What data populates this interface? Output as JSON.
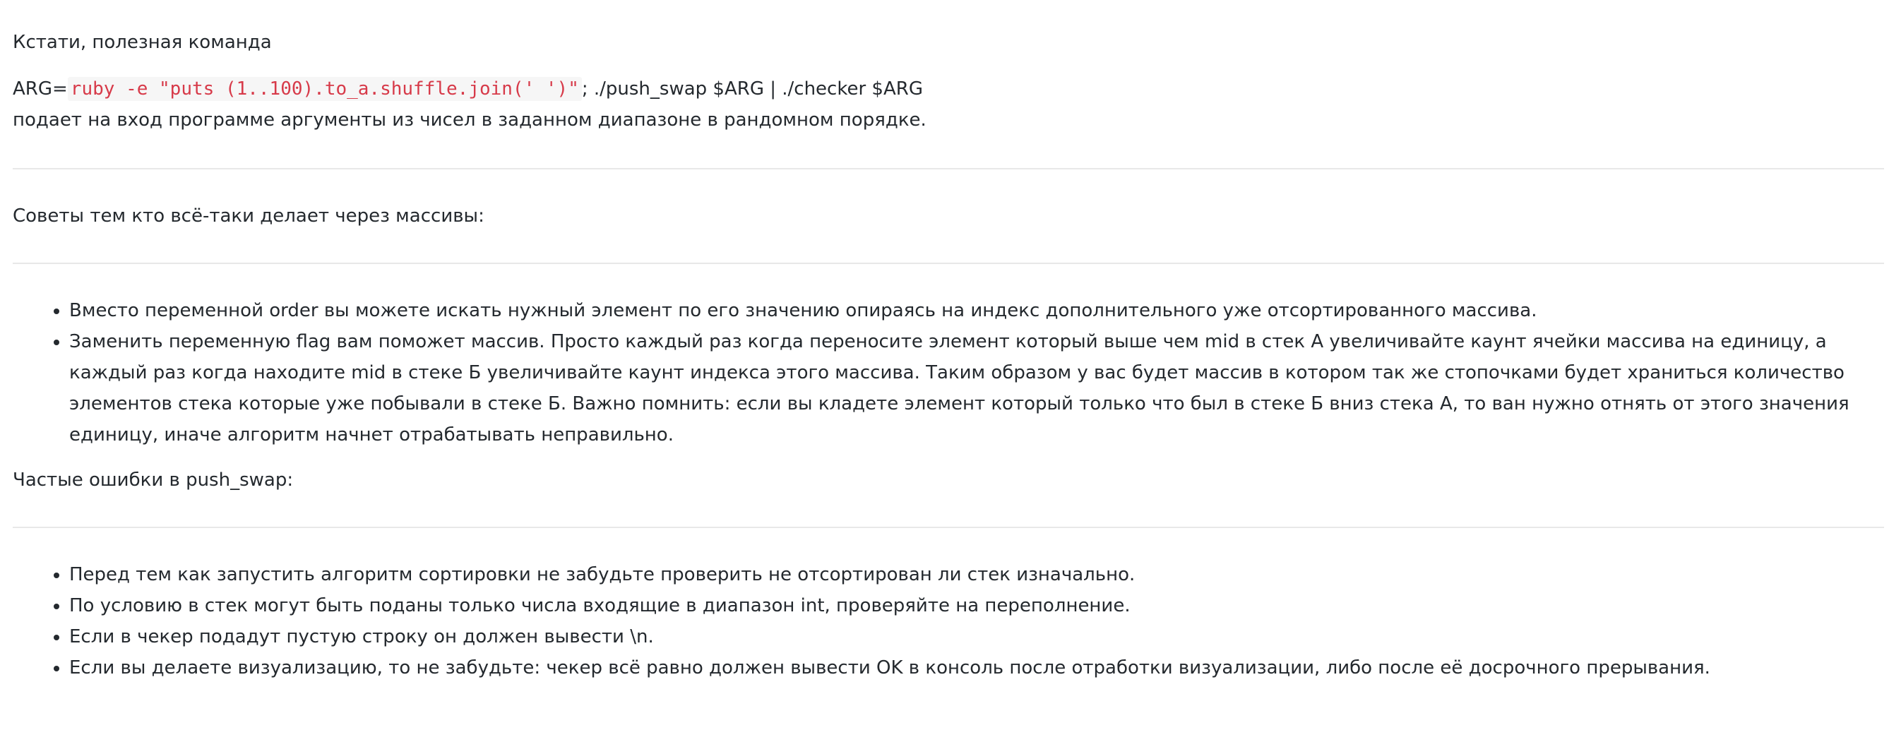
{
  "intro": {
    "tip_label": "Кстати, полезная команда",
    "command_prefix": "ARG=",
    "command_code": "ruby -e \"puts (1..100).to_a.shuffle.join(' ')\"",
    "command_suffix": "; ./push_swap $ARG | ./checker $ARG",
    "command_description": "подает на вход программе аргументы из чисел в заданном диапазоне в рандомном порядке."
  },
  "advice": {
    "heading": "Советы тем кто всё-таки делает через массивы:",
    "items": [
      "Вместо переменной order вы можете искать нужный элемент по его значению опираясь на индекс дополнительного уже отсортированного массива.",
      "Заменить переменную flag вам поможет массив. Просто каждый раз когда переносите элемент который выше чем mid в стек А увеличивайте каунт ячейки массива на единицу, а каждый раз когда находите mid в стеке Б увеличивайте каунт индекса этого массива. Таким образом у вас будет массив в котором так же стопочками будет храниться количество элементов стека которые уже побывали в стеке Б. Важно помнить: если вы кладете элемент который только что был в стеке Б вниз стека А, то ван нужно отнять от этого значения единицу, иначе алгоритм начнет отрабатывать неправильно."
    ]
  },
  "errors": {
    "heading": "Частые ошибки в push_swap:",
    "items": [
      "Перед тем как запустить алгоритм сортировки не забудьте проверить не отсортирован ли стек изначально.",
      "По условию в стек могут быть поданы только числа входящие в диапазон int, проверяйте на переполнение.",
      "Если в чекер подадут пустую строку он должен вывести \\n.",
      "Если вы делаете визуализацию, то не забудьте: чекер всё равно должен вывести OK в консоль после отработки визуализации, либо после её досрочного прерывания."
    ]
  },
  "colors": {
    "text": "#24292e",
    "code_text": "#d73a49",
    "code_background": "#f6f6f6",
    "divider": "#e8e8e8"
  }
}
